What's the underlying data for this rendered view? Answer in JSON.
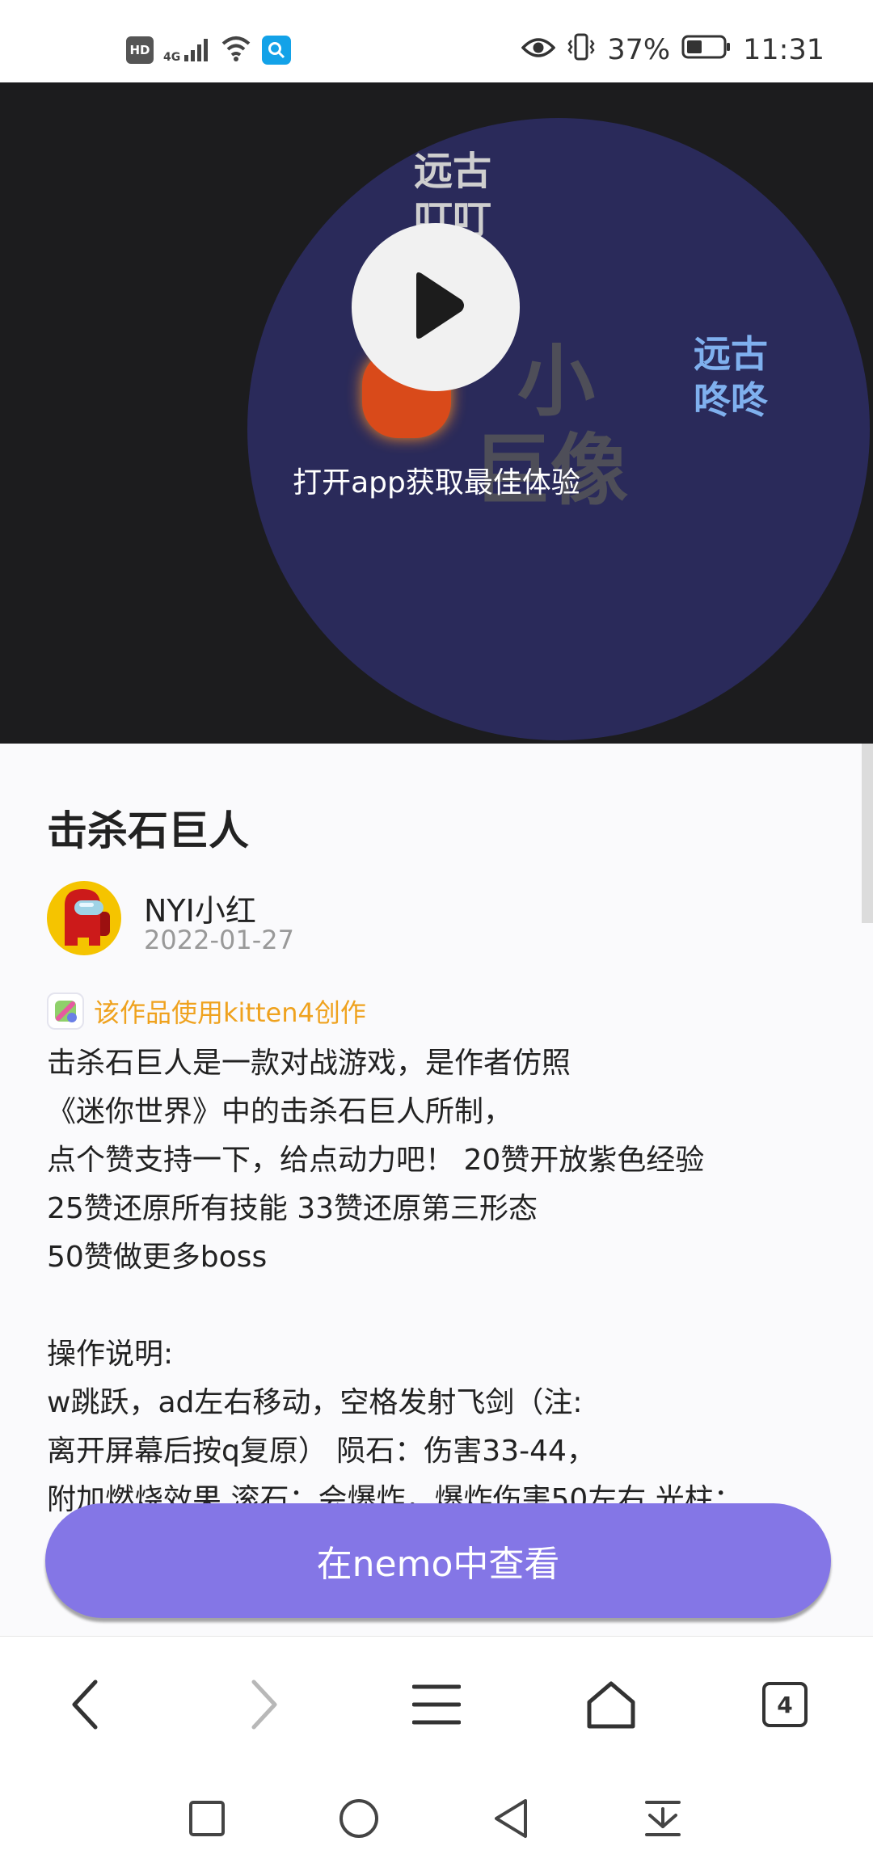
{
  "status_bar": {
    "hd": "HD",
    "network": "4G",
    "battery": "37%",
    "time": "11:31"
  },
  "video": {
    "background_text": {
      "top": "远古\n叮叮",
      "right": "远古\n咚咚",
      "center_upper": "小",
      "center_lower": "巨像"
    },
    "open_app_hint": "打开app获取最佳体验"
  },
  "post": {
    "title": "击杀石巨人",
    "author": "NYI小红",
    "date": "2022-01-27",
    "made_with": "该作品使用kitten4创作",
    "description_lines": [
      "击杀石巨人是一款对战游戏，是作者仿照",
      "《迷你世界》中的击杀石巨人所制，",
      "点个赞支持一下，给点动力吧！ 20赞开放紫色经验",
      "25赞还原所有技能 33赞还原第三形态",
      "50赞做更多boss",
      "",
      "操作说明:",
      "w跳跃，ad左右移动，空格发射飞剑（注:",
      "离开屏幕后按q复原） 陨石：伤害33-44，",
      "附加燃烧效果 滚石：会爆炸，爆炸伤害50左右 光柱："
    ]
  },
  "cta": {
    "label": "在nemo中查看"
  },
  "browser_toolbar": {
    "tab_count": "4"
  },
  "colors": {
    "accent_purple": "#8476e6",
    "kitten_orange": "#efa21e",
    "video_bg": "#1c1c1e",
    "disc_bg": "#2a2a5a"
  }
}
